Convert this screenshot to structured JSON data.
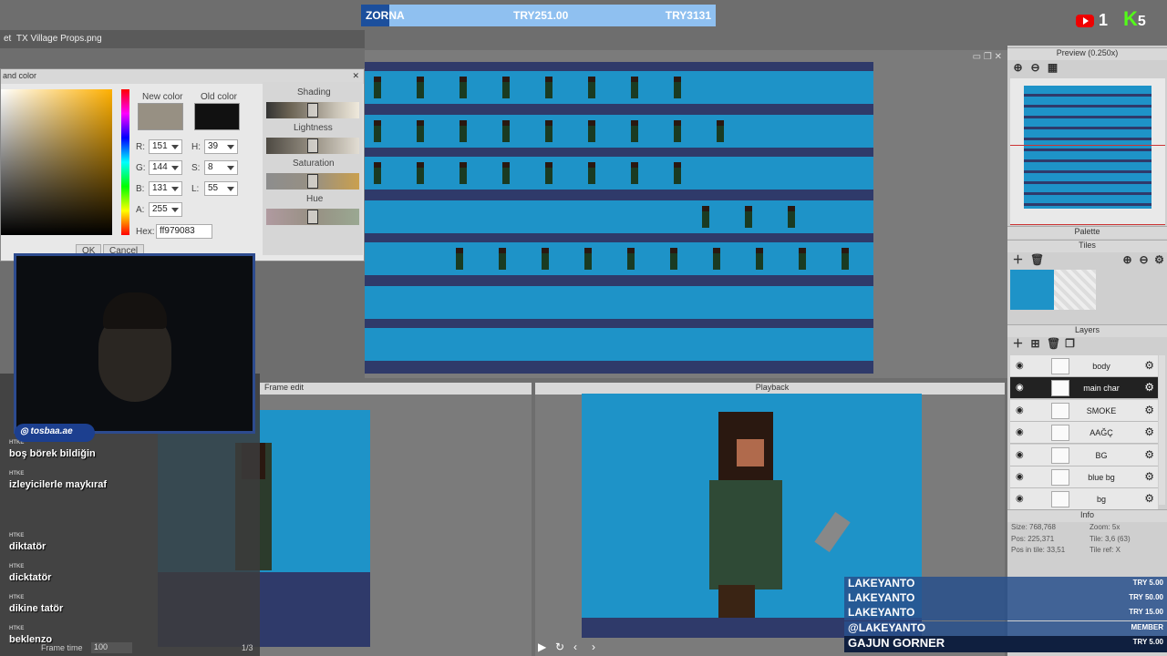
{
  "goal": {
    "name": "ZORNA",
    "current": "TRY251.00",
    "target": "TRY3131",
    "progress": 0.08
  },
  "file_tabs": {
    "prefix": "et",
    "active": "TX Village Props.png"
  },
  "socials": {
    "youtube_count": "1",
    "kick_count": "5"
  },
  "color_dialog": {
    "title": "and color",
    "new_color_label": "New color",
    "old_color_label": "Old color",
    "new_color": "#979083",
    "old_color": "#111111",
    "R": "151",
    "G": "144",
    "B": "131",
    "A": "255",
    "H": "39",
    "S": "8",
    "L": "55",
    "hex_label": "Hex:",
    "hex": "ff979083",
    "ok": "OK",
    "cancel": "Cancel",
    "shading": "Shading",
    "lightness": "Lightness",
    "saturation": "Saturation",
    "hue": "Hue"
  },
  "right_panel": {
    "preview_title": "Preview (0.250x)",
    "palette_title": "Palette",
    "tiles_title": "Tiles",
    "layers_title": "Layers",
    "info_title": "Info",
    "layers": [
      {
        "name": "body",
        "selected": false
      },
      {
        "name": "main char",
        "selected": true
      },
      {
        "name": "SMOKE",
        "selected": false
      },
      {
        "name": "AAĞÇ",
        "selected": false
      },
      {
        "name": "BG",
        "selected": false
      },
      {
        "name": "blue bg",
        "selected": false
      },
      {
        "name": "bg",
        "selected": false
      }
    ],
    "info": {
      "size": "Size: 768,768",
      "zoom": "Zoom: 5x",
      "pos": "Pos: 225,371",
      "tile": "Tile: 3,6 (63)",
      "pos_in_tile": "Pos in tile: 33,51",
      "tile_ref": "Tile ref: X"
    }
  },
  "panels": {
    "frame_edit": "Frame edit",
    "playback": "Playback",
    "frame_time_label": "Frame time",
    "frame_time": "100",
    "frame_counter": "1/3"
  },
  "chat": {
    "instagram": "tosbaa.ae",
    "badge": "HTKE",
    "messages": [
      "boş börek bildiğin",
      "izleyicilerle maykıraf",
      "diktatör",
      "dicktatör",
      "dikine tatör",
      "beklenzo"
    ]
  },
  "donations": [
    {
      "name": "LAKEYANTO",
      "amount": "TRY 5.00"
    },
    {
      "name": "LAKEYANTO",
      "amount": "TRY 50.00"
    },
    {
      "name": "LAKEYANTO",
      "amount": "TRY 15.00"
    },
    {
      "name": "@LAKEYANTO",
      "amount": "MEMBER"
    },
    {
      "name": "GAJUN GORNER",
      "amount": "TRY 5.00"
    }
  ]
}
